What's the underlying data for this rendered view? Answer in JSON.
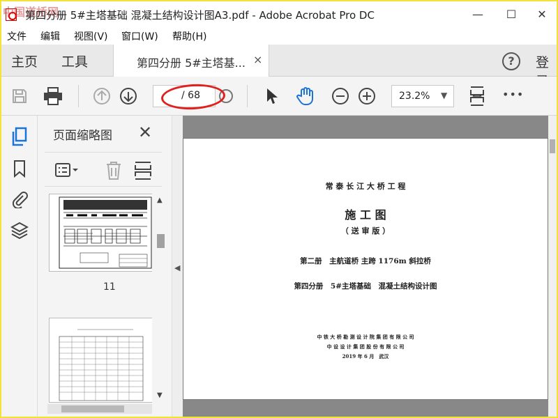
{
  "window": {
    "title": "第四分册 5#主塔基础 混凝土结构设计图A3.pdf - Adobe Acrobat Pro DC",
    "watermark": "中国道桥网",
    "minimize": "—",
    "maximize": "☐",
    "close": "✕"
  },
  "menu": [
    "文件",
    "编辑",
    "视图(V)",
    "窗口(W)",
    "帮助(H)"
  ],
  "tabs": {
    "home": "主页",
    "tools": "工具",
    "document": "第四分册 5#主塔基...",
    "close": "×",
    "help": "?",
    "login": "登录"
  },
  "toolbar": {
    "page_current": "",
    "page_total": "/ 68",
    "zoom": "23.2%",
    "zoom_caret": "▼",
    "more": "•••"
  },
  "thumbnails": {
    "title": "页面缩略图",
    "close": "✕",
    "page_label": "11"
  },
  "document": {
    "project": "常 泰 长 江 大 桥 工 程",
    "heading": "施 工 图",
    "subheading": "（ 送 审 版 ）",
    "volume": "第二册　主航道桥 主跨 1176m 斜拉桥",
    "part": "第四分册　5#主塔基础　混凝土结构设计图",
    "org1": "中 铁 大 桥 勘 测 设 计 院 集 团 有 限 公 司",
    "org2": "中 设 设 计 集 团 股 份 有 限 公 司",
    "date": "2019 年 6 月　武汉"
  },
  "colors": {
    "accent": "#1a73d9",
    "annotation": "#e0201c"
  }
}
